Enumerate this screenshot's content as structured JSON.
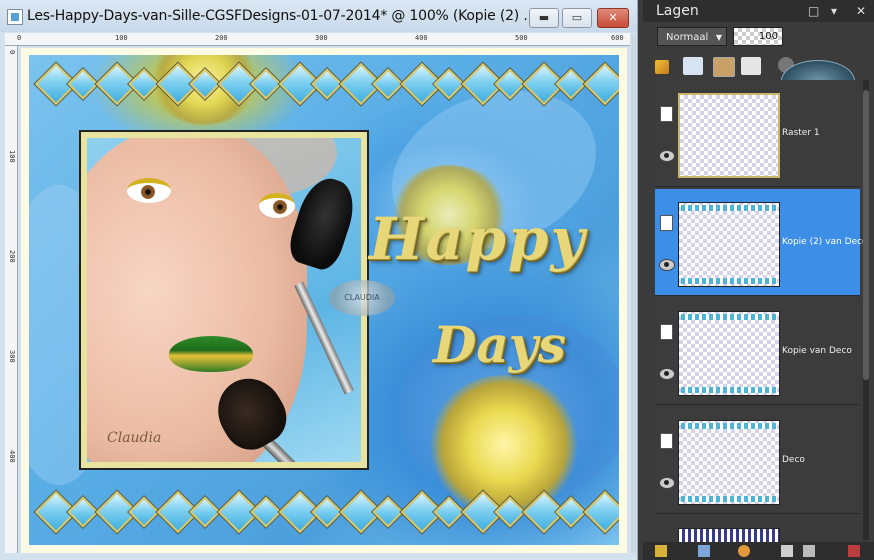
{
  "window": {
    "title": "Les-Happy-Days-van-Sille-CGSFDesigns-01-07-2014* @ 100% (Kopie (2) ...",
    "minimize_label": "▬",
    "maximize_label": "▭",
    "close_label": "✕"
  },
  "rulers": {
    "top": [
      "0",
      "100",
      "200",
      "300",
      "400",
      "500",
      "600"
    ],
    "left": [
      "0",
      "100",
      "200",
      "300",
      "400"
    ]
  },
  "artwork": {
    "headline_1": "Happy",
    "headline_2": "Days",
    "signature": "Claudia",
    "watermark": "CLAUDIA"
  },
  "layers_panel": {
    "title": "Lagen",
    "float_icon": "□",
    "pin_icon": "▾",
    "close_icon": "✕",
    "blend_mode": "Normaal",
    "opacity": "100",
    "layers": [
      {
        "name": "Raster 1",
        "selected": false
      },
      {
        "name": "Kopie (2) van Deco",
        "selected": true
      },
      {
        "name": "Kopie van Deco",
        "selected": false
      },
      {
        "name": "Deco",
        "selected": false
      }
    ]
  },
  "colors": {
    "selection": "#3d8ee6",
    "panel_bg": "#3b3b3b",
    "window_chrome": "#d4e1ee"
  }
}
